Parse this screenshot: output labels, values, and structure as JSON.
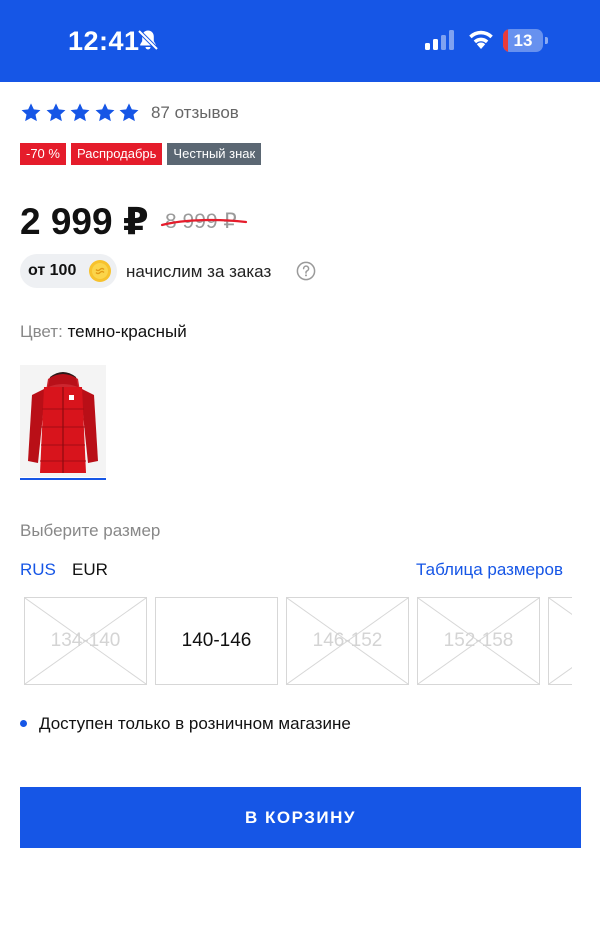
{
  "status_bar": {
    "time": "12:41",
    "battery_level": "13",
    "battery_fraction": 0.13,
    "icons": [
      "bell-slash-icon",
      "cellular-signal-icon",
      "wifi-icon",
      "battery-icon"
    ]
  },
  "product": {
    "rating": {
      "stars": 5,
      "reviews_label": "87 отзывов"
    },
    "badges": [
      {
        "text": "-70 %",
        "color": "#e51c2b"
      },
      {
        "text": "Распродабрь",
        "color": "#e51c2b"
      },
      {
        "text": "Честный знак",
        "color": "#5b6773"
      }
    ],
    "price": "2 999 ₽",
    "old_price": "8 999 ₽",
    "bonus": {
      "amount": "от 100",
      "label": "начислим за заказ"
    },
    "color": {
      "label": "Цвет:",
      "value": "темно-красный"
    },
    "size": {
      "title": "Выберите размер",
      "systems": [
        "RUS",
        "EUR"
      ],
      "active_system": "RUS",
      "table_link": "Таблица размеров",
      "options": [
        {
          "label": "134-140",
          "available": false
        },
        {
          "label": "140-146",
          "available": true
        },
        {
          "label": "146-152",
          "available": false
        },
        {
          "label": "152-158",
          "available": false
        },
        {
          "label": "",
          "available": false
        }
      ]
    },
    "availability": "Доступен только в розничном магазине",
    "cart_button": "В КОРЗИНУ"
  },
  "colors": {
    "accent": "#1656e6",
    "sale": "#e51c2b",
    "badge_gray": "#5b6773",
    "jacket_red": "#d8141c"
  }
}
